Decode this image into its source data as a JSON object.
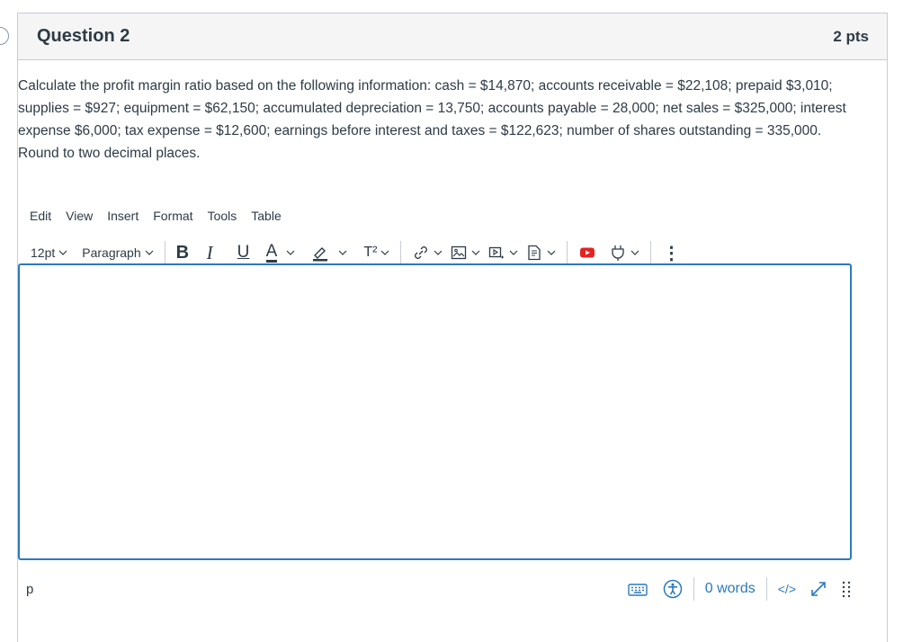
{
  "question": {
    "title": "Question 2",
    "points": "2 pts",
    "text": "Calculate the profit margin ratio based on the following information: cash = $14,870; accounts receivable = $22,108; prepaid $3,010; supplies = $927; equipment = $62,150; accumulated depreciation = 13,750; accounts payable = 28,000; net sales = $325,000; interest expense $6,000; tax expense = $12,600; earnings before interest and taxes = $122,623; number of shares outstanding = 335,000. Round to two decimal places."
  },
  "menubar": {
    "edit": "Edit",
    "view": "View",
    "insert": "Insert",
    "format": "Format",
    "tools": "Tools",
    "table": "Table"
  },
  "toolbar": {
    "font_size": "12pt",
    "block_format": "Paragraph",
    "bold": "B",
    "italic": "I",
    "underline": "U",
    "text_color": "A",
    "superscript": "T²",
    "more": "⋮",
    "icons": [
      "chevron-down-icon",
      "highlighter-icon",
      "link-icon",
      "image-icon",
      "media-icon",
      "document-icon",
      "youtube-icon",
      "plugin-icon",
      "more-vertical-icon"
    ]
  },
  "editor": {
    "content": ""
  },
  "statusbar": {
    "path": "p",
    "word_count": "0 words",
    "html_toggle": "</>",
    "icons": [
      "keyboard-icon",
      "accessibility-icon",
      "fullscreen-icon",
      "resize-handle-icon"
    ]
  },
  "colors": {
    "accent": "#2b7abc",
    "text": "#2d3b45",
    "border": "#c7cdd1",
    "header_bg": "#f5f5f5",
    "youtube_red": "#e52222"
  }
}
